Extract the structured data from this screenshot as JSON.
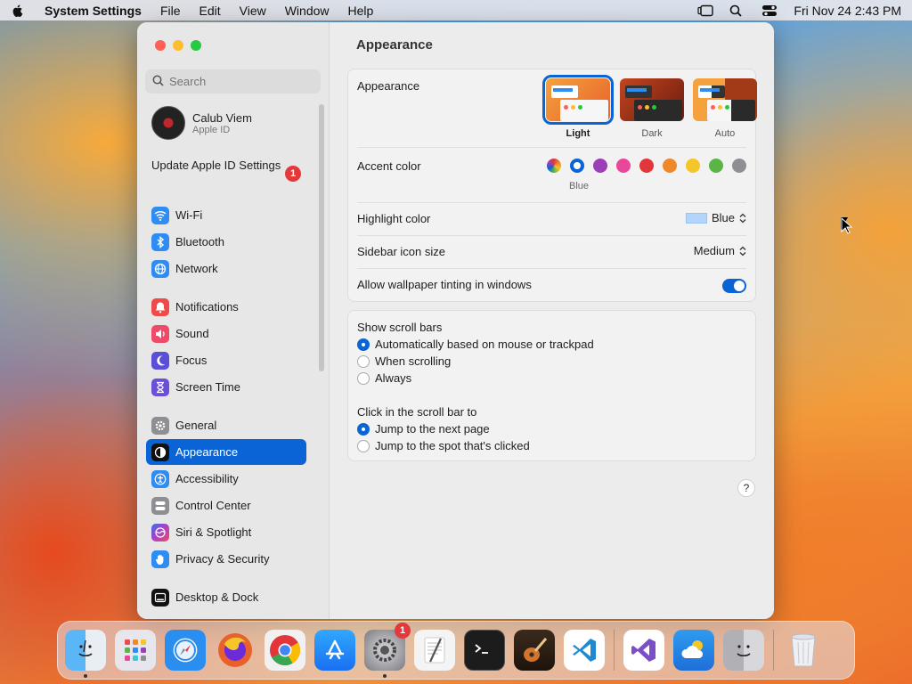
{
  "menubar": {
    "app": "System Settings",
    "items": [
      "File",
      "Edit",
      "View",
      "Window",
      "Help"
    ],
    "clock": "Fri Nov 24  2:43 PM"
  },
  "sidebar": {
    "search_placeholder": "Search",
    "account": {
      "name": "Calub Viem",
      "subtitle": "Apple ID"
    },
    "update": {
      "label": "Update Apple ID Settings",
      "badge": "1"
    },
    "items": [
      {
        "label": "Wi-Fi",
        "icon": "wifi-icon",
        "color": "#2f8cf3"
      },
      {
        "label": "Bluetooth",
        "icon": "bluetooth-icon",
        "color": "#2f8cf3"
      },
      {
        "label": "Network",
        "icon": "network-icon",
        "color": "#2f8cf3"
      },
      {
        "label": "Notifications",
        "icon": "bell-icon",
        "color": "#f04a4a"
      },
      {
        "label": "Sound",
        "icon": "speaker-icon",
        "color": "#f04a6a"
      },
      {
        "label": "Focus",
        "icon": "moon-icon",
        "color": "#5b4fd8"
      },
      {
        "label": "Screen Time",
        "icon": "hourglass-icon",
        "color": "#6b4fd8"
      },
      {
        "label": "General",
        "icon": "gear-icon",
        "color": "#8e8e93"
      },
      {
        "label": "Appearance",
        "icon": "appearance-icon",
        "color": "#111111"
      },
      {
        "label": "Accessibility",
        "icon": "accessibility-icon",
        "color": "#2f8cf3"
      },
      {
        "label": "Control Center",
        "icon": "control-center-icon",
        "color": "#8e8e93"
      },
      {
        "label": "Siri & Spotlight",
        "icon": "siri-icon",
        "color": "#b040c0"
      },
      {
        "label": "Privacy & Security",
        "icon": "hand-icon",
        "color": "#2f8cf3"
      },
      {
        "label": "Desktop & Dock",
        "icon": "dock-icon",
        "color": "#111111"
      }
    ],
    "selected": "Appearance"
  },
  "content": {
    "title": "Appearance",
    "appearance": {
      "label": "Appearance",
      "options": [
        "Light",
        "Dark",
        "Auto"
      ],
      "selected": "Light"
    },
    "accent": {
      "label": "Accent color",
      "colors": [
        "multicolor",
        "#0a64d6",
        "#9b3fb8",
        "#e8479a",
        "#e2363a",
        "#f0882a",
        "#f5c52a",
        "#5ab546",
        "#8e8e93"
      ],
      "selected_name": "Blue"
    },
    "highlight": {
      "label": "Highlight color",
      "value": "Blue",
      "swatch": "#b3d4fb"
    },
    "sidebar_icon": {
      "label": "Sidebar icon size",
      "value": "Medium"
    },
    "tinting": {
      "label": "Allow wallpaper tinting in windows",
      "on": true
    },
    "scroll": {
      "label": "Show scroll bars",
      "options": [
        "Automatically based on mouse or trackpad",
        "When scrolling",
        "Always"
      ],
      "selected": 0
    },
    "click": {
      "label": "Click in the scroll bar to",
      "options": [
        "Jump to the next page",
        "Jump to the spot that's clicked"
      ],
      "selected": 0
    },
    "help": "?"
  },
  "dock": {
    "apps": [
      {
        "name": "finder-icon",
        "color": "#3d9bf0",
        "running": true
      },
      {
        "name": "launchpad-icon",
        "color": "#e6e6ec",
        "running": false
      },
      {
        "name": "safari-icon",
        "color": "#2a8ef0",
        "running": false
      },
      {
        "name": "firefox-icon",
        "color": "#e8612c",
        "running": false
      },
      {
        "name": "chrome-icon",
        "color": "#f1f1f1",
        "running": false
      },
      {
        "name": "app-store-icon",
        "color": "#1c8cf5",
        "running": false
      },
      {
        "name": "system-settings-icon",
        "color": "#8e8e93",
        "running": true,
        "badge": "1"
      },
      {
        "name": "textedit-icon",
        "color": "#f4f4f4",
        "running": false
      },
      {
        "name": "terminal-icon",
        "color": "#1c1c1c",
        "running": false
      },
      {
        "name": "garageband-icon",
        "color": "#d0742e",
        "running": false
      },
      {
        "name": "vscode-icon",
        "color": "#ffffff",
        "running": false
      }
    ],
    "recent": [
      {
        "name": "visual-studio-icon",
        "color": "#ffffff"
      },
      {
        "name": "weather-icon",
        "color": "#2a8ef0"
      },
      {
        "name": "finder-recent-icon",
        "color": "#b0b0b5"
      }
    ],
    "trash": {
      "name": "trash-icon",
      "color": "#e4e4e8"
    }
  }
}
